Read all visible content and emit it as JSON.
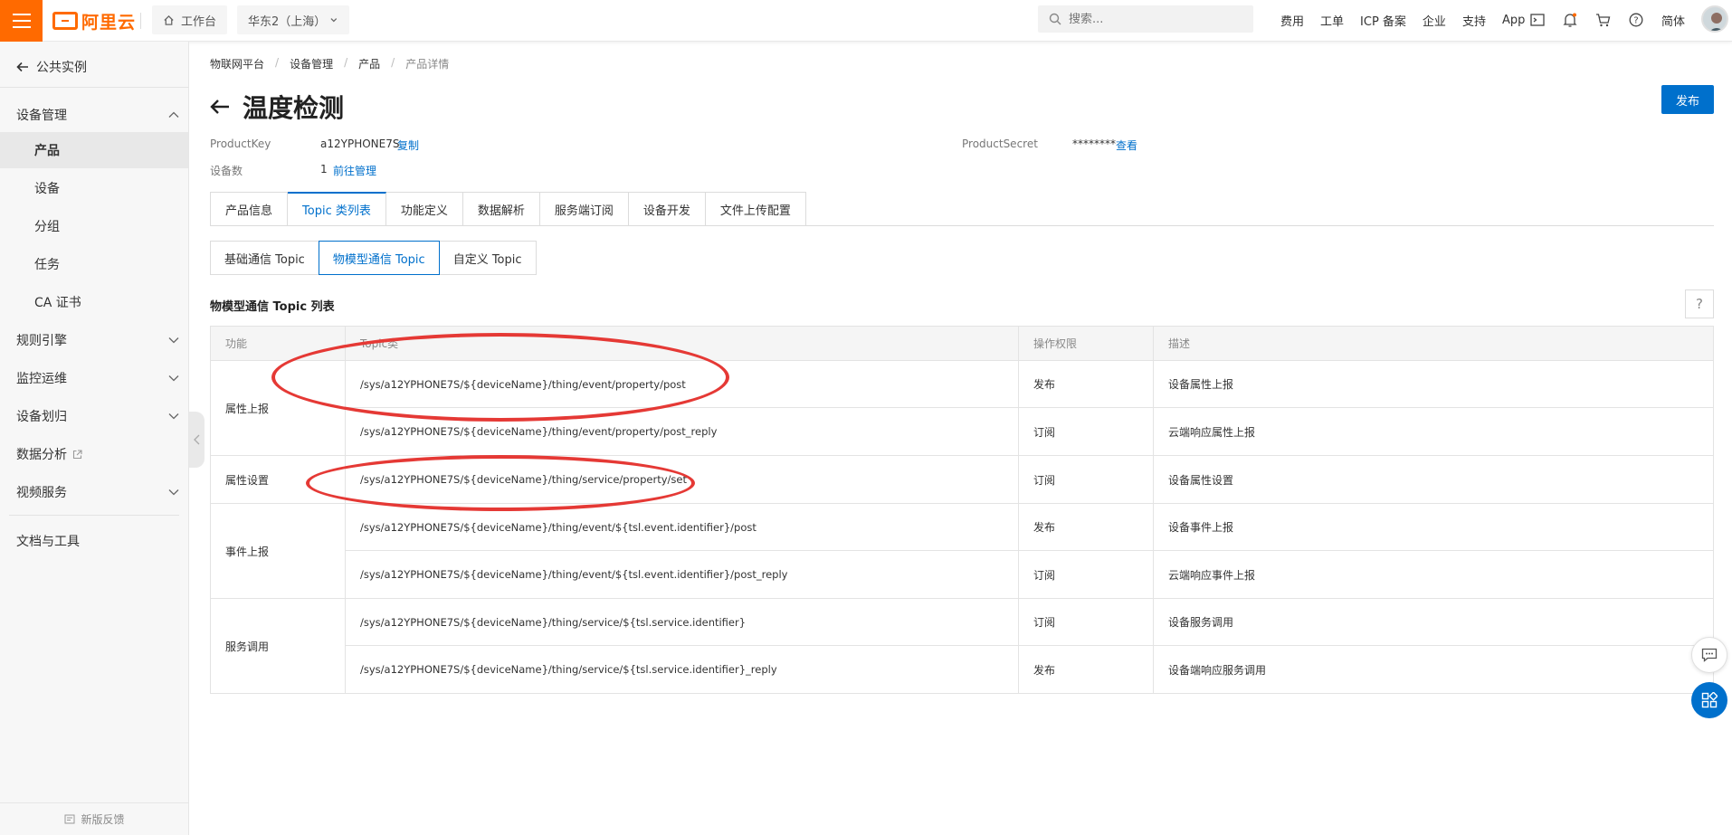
{
  "topbar": {
    "brand": "阿里云",
    "workbench": "工作台",
    "region": "华东2（上海）",
    "search_placeholder": "搜索...",
    "links": [
      "费用",
      "工单",
      "ICP 备案",
      "企业",
      "支持",
      "App"
    ],
    "lang": "简体"
  },
  "sidebar": {
    "back_label": "公共实例",
    "device_mgmt": "设备管理",
    "items": [
      "产品",
      "设备",
      "分组",
      "任务",
      "CA 证书"
    ],
    "groups": [
      "规则引擎",
      "监控运维",
      "设备划归",
      "数据分析",
      "视频服务"
    ],
    "docs": "文档与工具",
    "feedback": "新版反馈"
  },
  "breadcrumb": [
    "物联网平台",
    "设备管理",
    "产品",
    "产品详情"
  ],
  "page_title": "温度检测",
  "publish_label": "发布",
  "meta": {
    "product_key_label": "ProductKey",
    "product_key": "a12YPHONE7S",
    "copy_label": "复制",
    "product_secret_label": "ProductSecret",
    "product_secret": "********",
    "view_label": "查看",
    "device_count_label": "设备数",
    "device_count": "1",
    "manage_label": "前往管理"
  },
  "tabs": [
    "产品信息",
    "Topic 类列表",
    "功能定义",
    "数据解析",
    "服务端订阅",
    "设备开发",
    "文件上传配置"
  ],
  "subtabs": [
    "基础通信 Topic",
    "物模型通信 Topic",
    "自定义 Topic"
  ],
  "list_title": "物模型通信 Topic 列表",
  "table": {
    "headers": [
      "功能",
      "Topic类",
      "操作权限",
      "描述"
    ],
    "groups": [
      {
        "label": "属性上报",
        "rows": [
          {
            "topic": "/sys/a12YPHONE7S/${deviceName}/thing/event/property/post",
            "perm": "发布",
            "desc": "设备属性上报"
          },
          {
            "topic": "/sys/a12YPHONE7S/${deviceName}/thing/event/property/post_reply",
            "perm": "订阅",
            "desc": "云端响应属性上报"
          }
        ]
      },
      {
        "label": "属性设置",
        "rows": [
          {
            "topic": "/sys/a12YPHONE7S/${deviceName}/thing/service/property/set",
            "perm": "订阅",
            "desc": "设备属性设置"
          }
        ]
      },
      {
        "label": "事件上报",
        "rows": [
          {
            "topic": "/sys/a12YPHONE7S/${deviceName}/thing/event/${tsl.event.identifier}/post",
            "perm": "发布",
            "desc": "设备事件上报"
          },
          {
            "topic": "/sys/a12YPHONE7S/${deviceName}/thing/event/${tsl.event.identifier}/post_reply",
            "perm": "订阅",
            "desc": "云端响应事件上报"
          }
        ]
      },
      {
        "label": "服务调用",
        "rows": [
          {
            "topic": "/sys/a12YPHONE7S/${deviceName}/thing/service/${tsl.service.identifier}",
            "perm": "订阅",
            "desc": "设备服务调用"
          },
          {
            "topic": "/sys/a12YPHONE7S/${deviceName}/thing/service/${tsl.service.identifier}_reply",
            "perm": "发布",
            "desc": "设备端响应服务调用"
          }
        ]
      }
    ]
  },
  "colors": {
    "brand": "#ff6a00",
    "link": "#0070cc",
    "annotation": "#e53935"
  }
}
